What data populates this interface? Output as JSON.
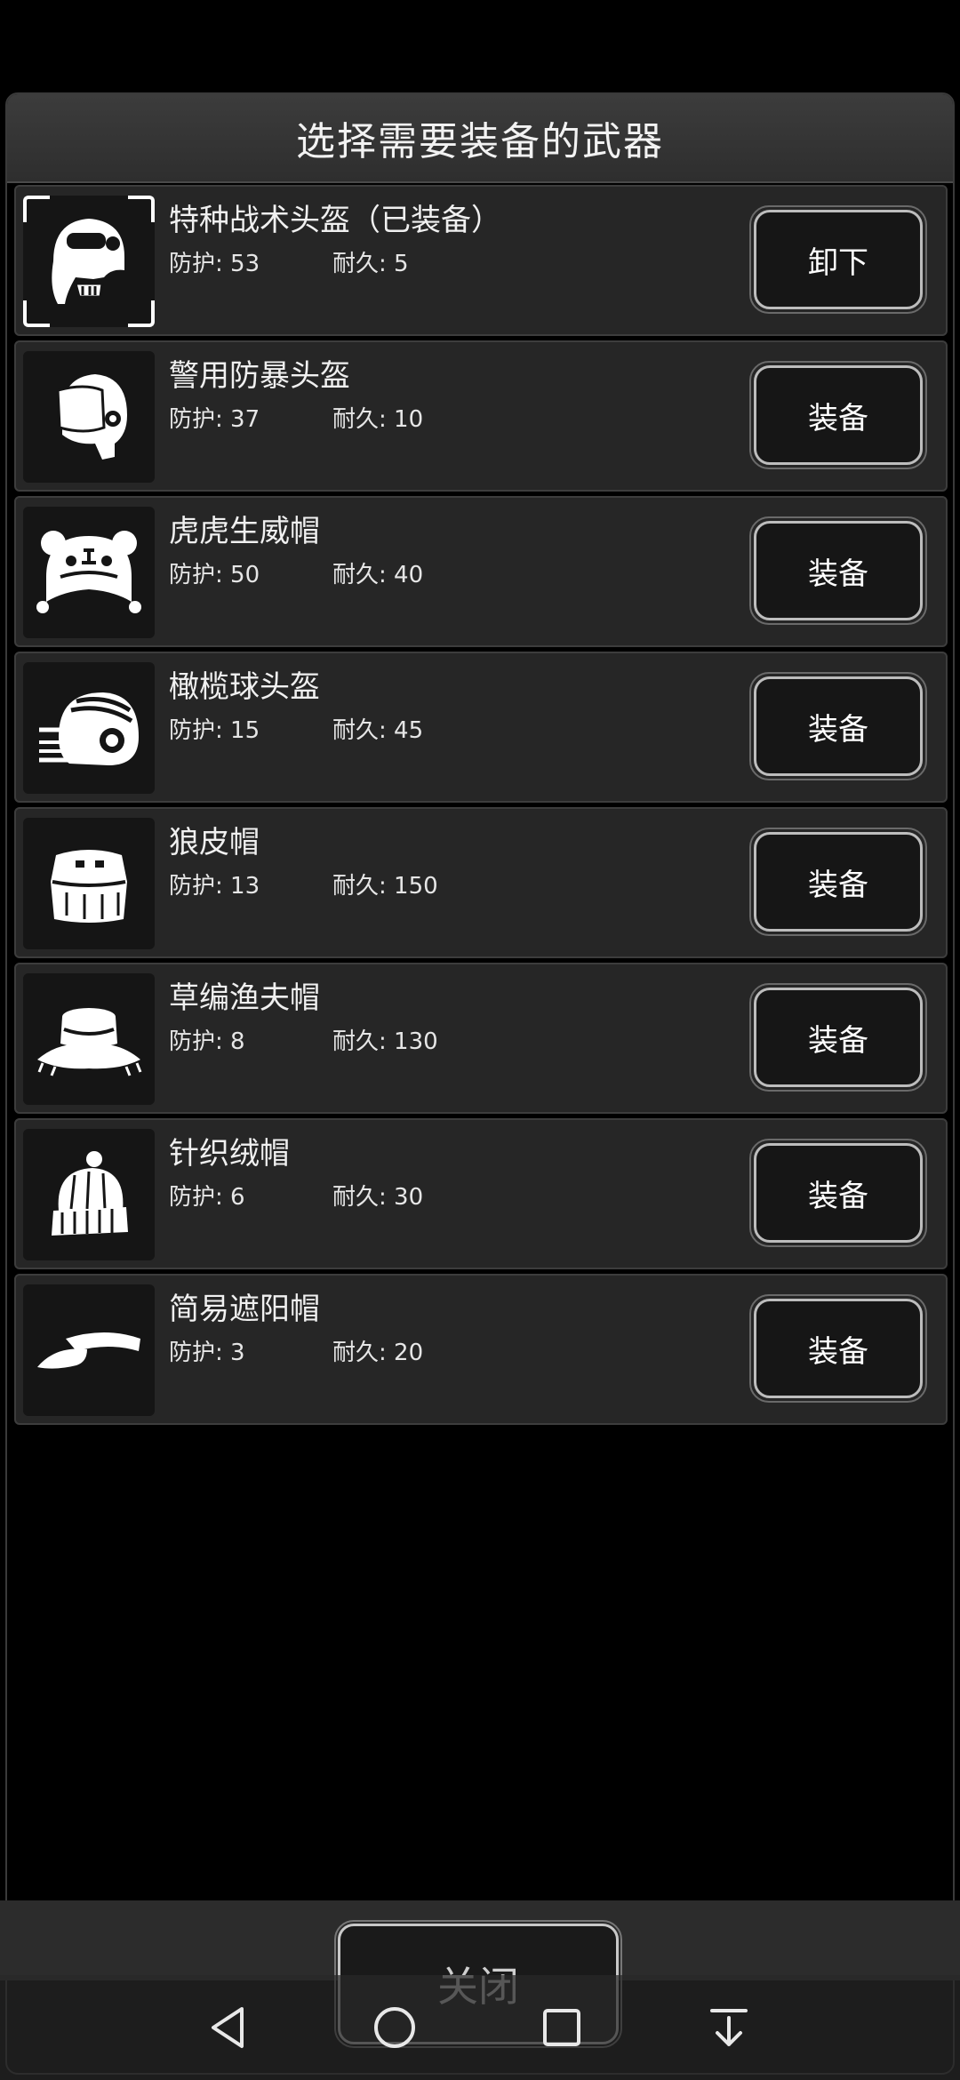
{
  "dialog": {
    "title": "选择需要装备的武器"
  },
  "items": [
    {
      "name": "特种战术头盔（已装备）",
      "defense": "防护: 53",
      "durability": "耐久: 5",
      "action": "卸下",
      "icon": "tactical-helmet-icon"
    },
    {
      "name": "警用防暴头盔",
      "defense": "防护: 37",
      "durability": "耐久: 10",
      "action": "装备",
      "icon": "riot-helmet-icon"
    },
    {
      "name": "虎虎生威帽",
      "defense": "防护: 50",
      "durability": "耐久: 40",
      "action": "装备",
      "icon": "tiger-hat-icon"
    },
    {
      "name": "橄榄球头盔",
      "defense": "防护: 15",
      "durability": "耐久: 45",
      "action": "装备",
      "icon": "football-helmet-icon"
    },
    {
      "name": "狼皮帽",
      "defense": "防护: 13",
      "durability": "耐久: 150",
      "action": "装备",
      "icon": "fur-hat-icon"
    },
    {
      "name": "草编渔夫帽",
      "defense": "防护: 8",
      "durability": "耐久: 130",
      "action": "装备",
      "icon": "straw-bucket-hat-icon"
    },
    {
      "name": "针织绒帽",
      "defense": "防护: 6",
      "durability": "耐久: 30",
      "action": "装备",
      "icon": "knit-beanie-icon"
    },
    {
      "name": "简易遮阳帽",
      "defense": "防护: 3",
      "durability": "耐久: 20",
      "action": "装备",
      "icon": "sun-visor-icon"
    }
  ],
  "footer": {
    "close_label": "关闭"
  },
  "system_nav": {
    "back": "back-icon",
    "home": "home-icon",
    "recents": "recents-icon",
    "notifications": "pull-down-icon"
  }
}
